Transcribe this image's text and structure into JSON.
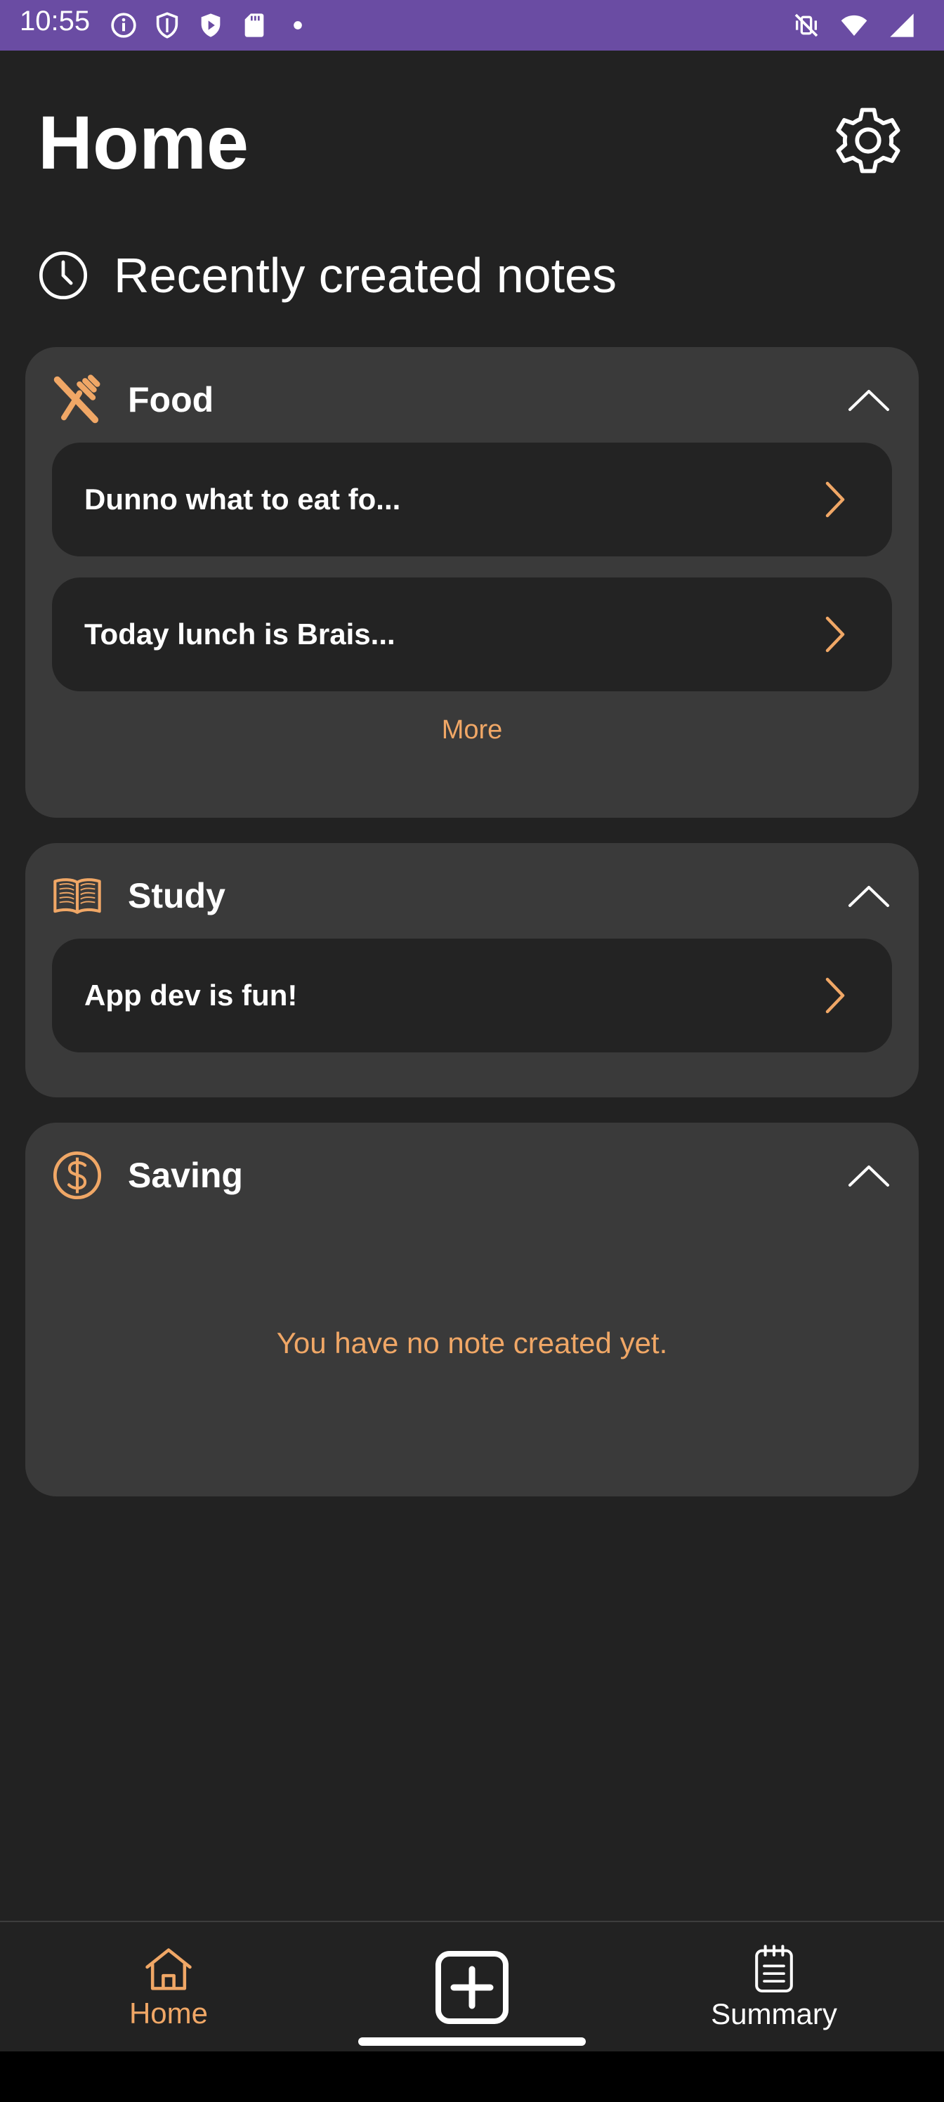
{
  "status_bar": {
    "time": "10:55",
    "left_icons": [
      "info-icon",
      "shield-icon",
      "play-protect-icon",
      "sd-card-icon",
      "dot-icon"
    ],
    "right_icons": [
      "mute-vibrate-icon",
      "wifi-icon",
      "cell-signal-icon"
    ]
  },
  "header": {
    "title": "Home",
    "settings_icon": "gear-icon"
  },
  "recent": {
    "title": "Recently created notes",
    "icon": "clock-icon"
  },
  "categories": [
    {
      "name": "Food",
      "icon": "utensils-icon",
      "notes": [
        "Dunno what to eat fo...",
        "Today lunch is Brais..."
      ],
      "more_label": "More"
    },
    {
      "name": "Study",
      "icon": "book-icon",
      "notes": [
        "App dev is fun!"
      ]
    },
    {
      "name": "Saving",
      "icon": "dollar-icon",
      "notes": [],
      "empty_message": "You have no note created yet."
    }
  ],
  "bottom_nav": {
    "home_label": "Home",
    "add_icon": "add-square-icon",
    "summary_label": "Summary"
  },
  "colors": {
    "accent": "#f0a766",
    "status_bar": "#6a4ca3",
    "background": "#222222",
    "card": "#3a3a3a",
    "note_row": "#232323"
  }
}
